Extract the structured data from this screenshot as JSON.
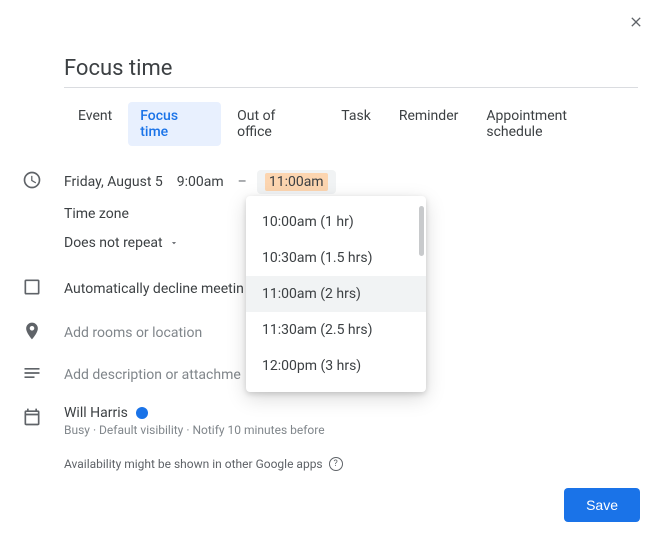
{
  "title": "Focus time",
  "tabs": [
    {
      "label": "Event"
    },
    {
      "label": "Focus time"
    },
    {
      "label": "Out of office"
    },
    {
      "label": "Task"
    },
    {
      "label": "Reminder"
    },
    {
      "label": "Appointment schedule"
    }
  ],
  "active_tab_index": 1,
  "schedule": {
    "date": "Friday, August 5",
    "start_time": "9:00am",
    "end_time": "11:00am",
    "timezone_label": "Time zone",
    "repeat": "Does not repeat"
  },
  "decline_text": "Automatically decline meetin",
  "location_placeholder": "Add rooms or location",
  "description_placeholder": "Add description or attachme",
  "organizer": {
    "name": "Will Harris",
    "meta": "Busy · Default visibility · Notify 10 minutes before"
  },
  "availability_note": "Availability might be shown in other Google apps",
  "save_label": "Save",
  "end_time_options": [
    {
      "label": "10:00am (1 hr)"
    },
    {
      "label": "10:30am (1.5 hrs)"
    },
    {
      "label": "11:00am (2 hrs)"
    },
    {
      "label": "11:30am (2.5 hrs)"
    },
    {
      "label": "12:00pm (3 hrs)"
    }
  ],
  "selected_option_index": 2
}
